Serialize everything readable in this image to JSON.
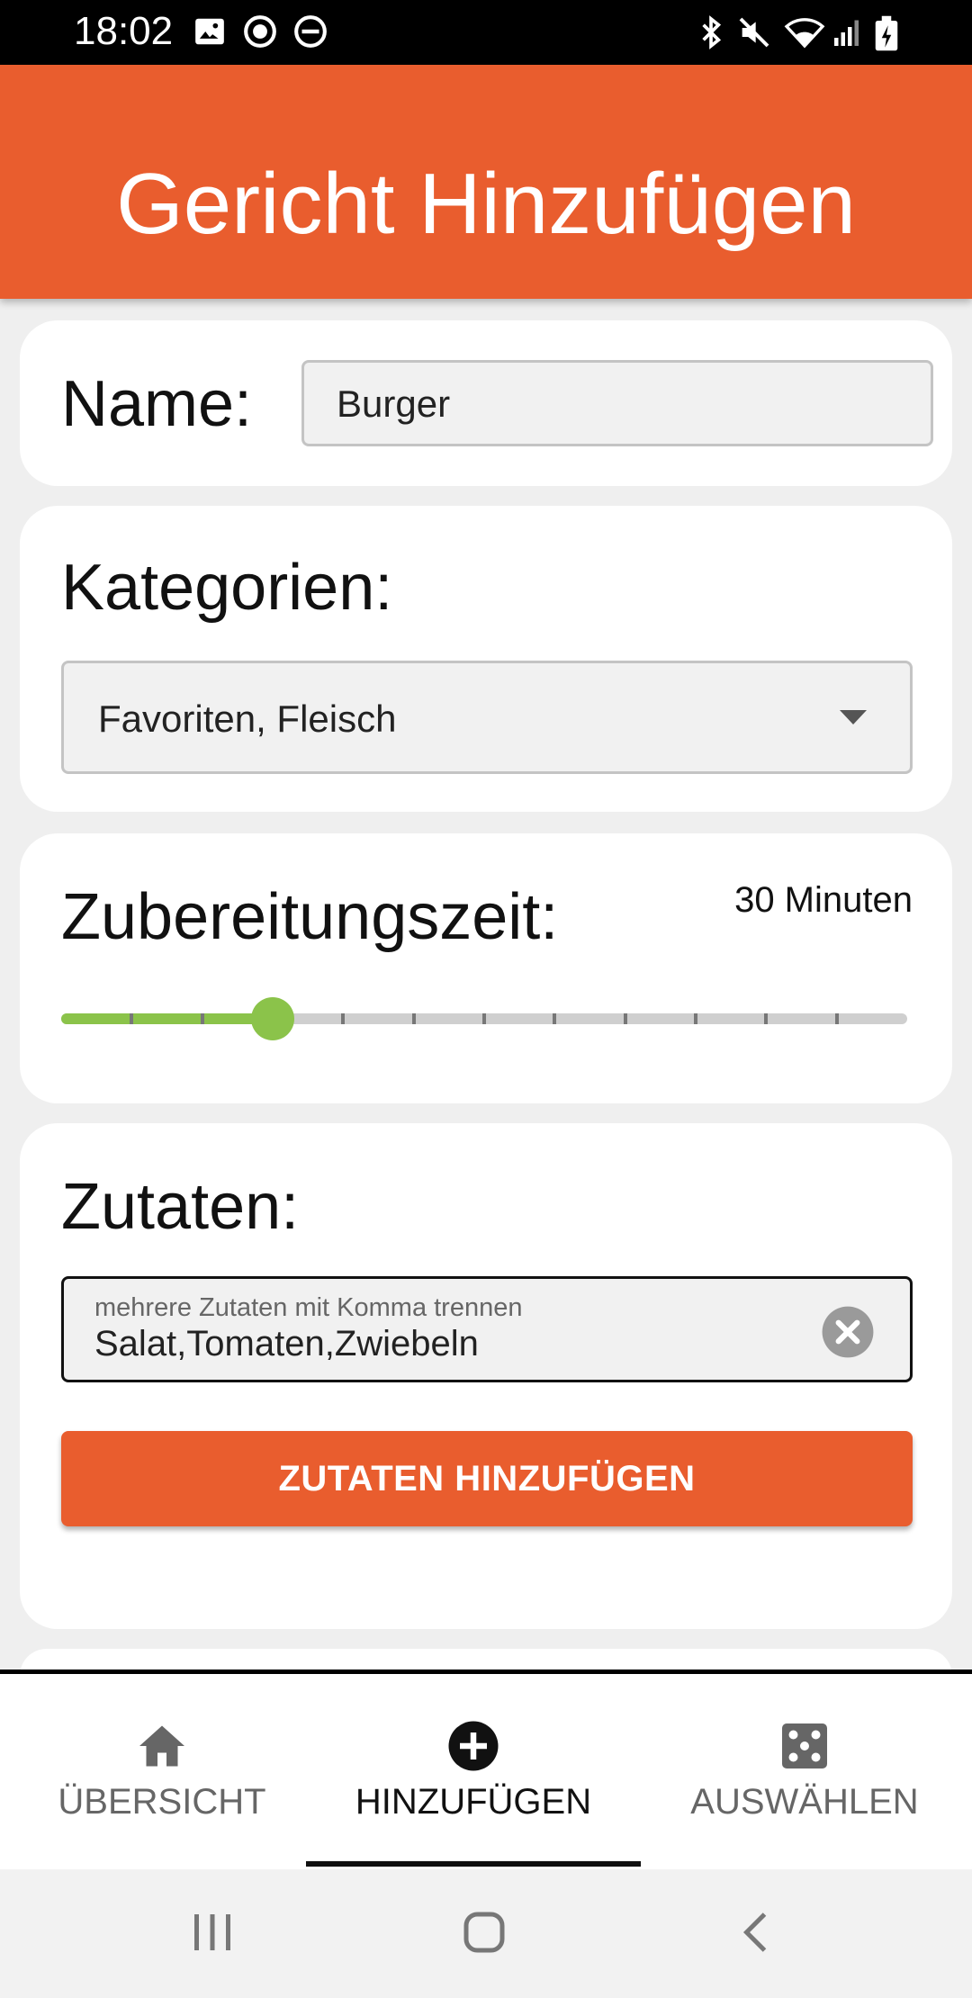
{
  "status_bar": {
    "time": "18:02",
    "left_icons": [
      "image-icon",
      "play-circle-icon",
      "do-not-disturb-icon"
    ],
    "right_icons": [
      "bluetooth-icon",
      "mute-icon",
      "wifi-icon",
      "signal-icon",
      "battery-charging-icon"
    ]
  },
  "app_bar": {
    "title": "Gericht Hinzufügen"
  },
  "name_card": {
    "label": "Name:",
    "value": "Burger"
  },
  "categories_card": {
    "label": "Kategorien:",
    "selected": "Favoriten, Fleisch",
    "icon": "dropdown-arrow-icon"
  },
  "time_card": {
    "label": "Zubereitungszeit:",
    "value_text": "30 Minuten",
    "slider": {
      "value": 3,
      "min": 0,
      "max": 12,
      "active_color": "#8bc34a"
    }
  },
  "ingredients_card": {
    "label": "Zutaten:",
    "input_hint": "mehrere Zutaten mit Komma trennen",
    "input_value": "Salat,Tomaten,Zwiebeln",
    "clear_icon": "clear-icon",
    "button_label": "ZUTATEN HINZUFÜGEN"
  },
  "bottom_nav": {
    "items": [
      {
        "label": "ÜBERSICHT",
        "icon": "home-icon",
        "active": false
      },
      {
        "label": "HINZUFÜGEN",
        "icon": "add-circle-icon",
        "active": true
      },
      {
        "label": "AUSWÄHLEN",
        "icon": "dice-icon",
        "active": false
      }
    ]
  },
  "system_nav": [
    "recent-apps-icon",
    "home-button-icon",
    "back-icon"
  ],
  "colors": {
    "accent": "#e95d2e",
    "slider": "#8bc34a",
    "background": "#efefef"
  }
}
